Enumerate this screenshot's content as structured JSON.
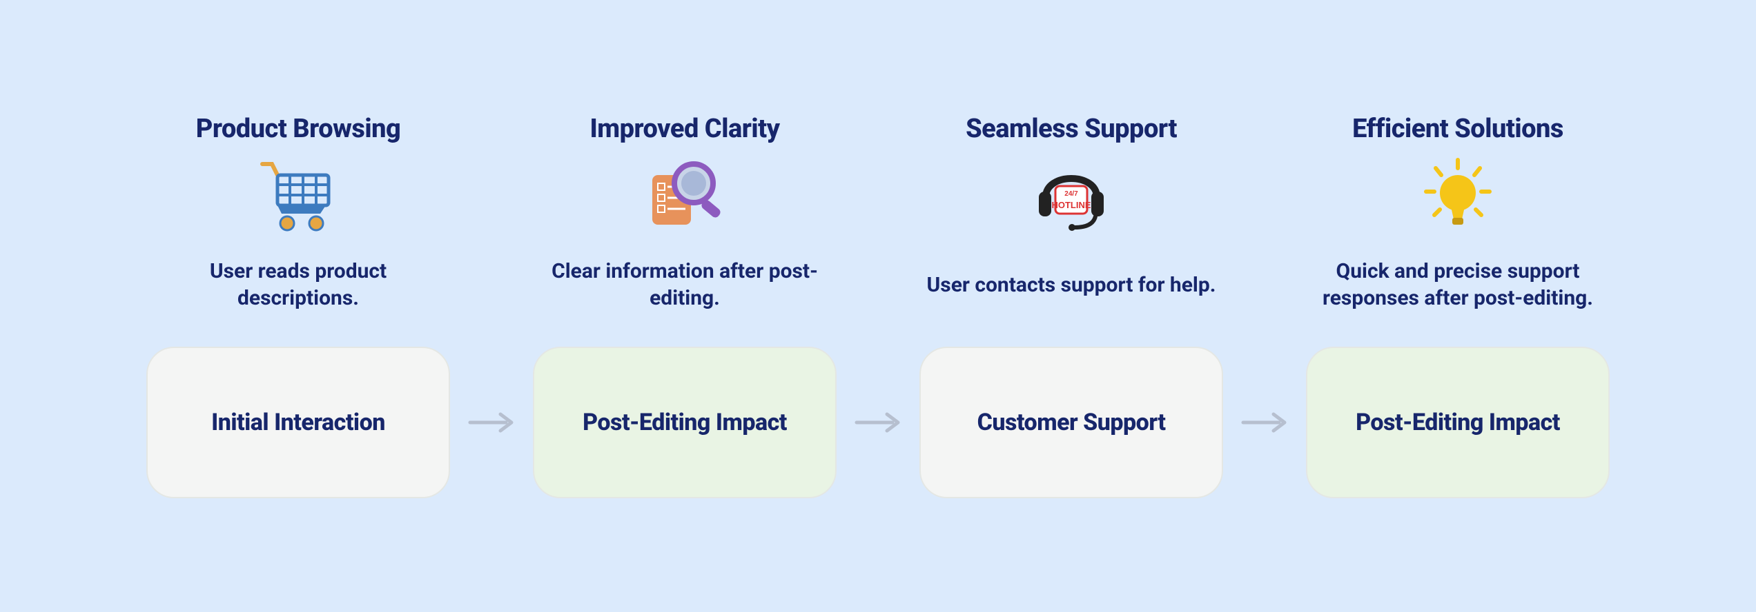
{
  "steps": [
    {
      "title": "Product Browsing",
      "description": "User reads product descriptions.",
      "card": "Initial Interaction",
      "cardClass": "grey",
      "iconName": "shopping-cart-icon"
    },
    {
      "title": "Improved Clarity",
      "description": "Clear information after post-editing.",
      "card": "Post-Editing Impact",
      "cardClass": "green",
      "iconName": "magnifier-document-icon"
    },
    {
      "title": "Seamless Support",
      "description": "User contacts support for help.",
      "card": "Customer Support",
      "cardClass": "grey",
      "iconName": "headset-hotline-icon",
      "badgeTop": "24/7",
      "badgeMain": "HOTLINE"
    },
    {
      "title": "Efficient Solutions",
      "description": "Quick and precise support responses after post-editing.",
      "card": "Post-Editing Impact",
      "cardClass": "green",
      "iconName": "lightbulb-icon"
    }
  ]
}
